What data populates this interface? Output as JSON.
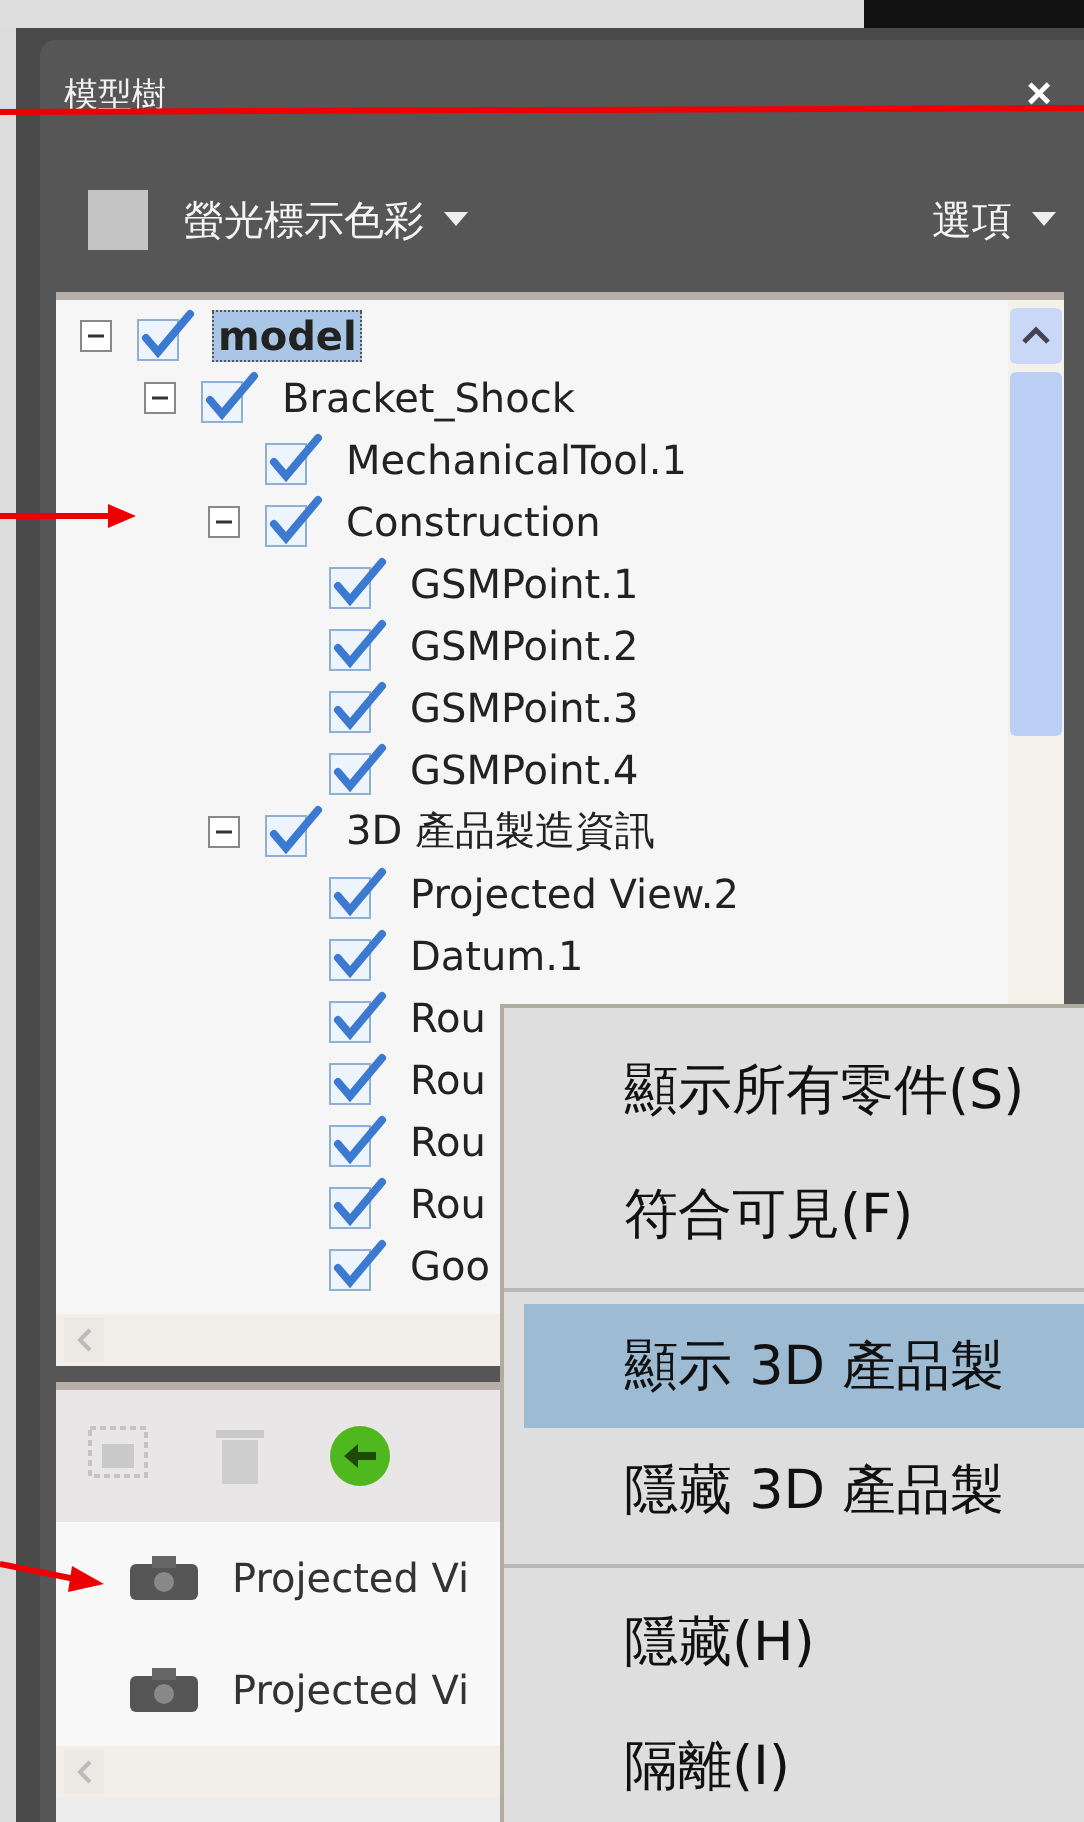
{
  "panel": {
    "title": "模型樹",
    "close": "×"
  },
  "toolbar": {
    "highlight_label": "螢光標示色彩",
    "options_label": "選項"
  },
  "tree": [
    {
      "label": "model",
      "checked": true,
      "selected": true,
      "expanded": true,
      "children": [
        {
          "label": "Bracket_Shock",
          "checked": true,
          "selected": false,
          "expanded": true,
          "children": [
            {
              "label": "MechanicalTool.1",
              "checked": true,
              "selected": false
            },
            {
              "label": "Construction",
              "checked": true,
              "selected": false,
              "expanded": true,
              "children": [
                {
                  "label": "GSMPoint.1",
                  "checked": true,
                  "selected": false
                },
                {
                  "label": "GSMPoint.2",
                  "checked": true,
                  "selected": false
                },
                {
                  "label": "GSMPoint.3",
                  "checked": true,
                  "selected": false
                },
                {
                  "label": "GSMPoint.4",
                  "checked": true,
                  "selected": false
                }
              ]
            },
            {
              "label": "3D 產品製造資訊",
              "checked": true,
              "selected": false,
              "expanded": true,
              "children": [
                {
                  "label": "Projected View.2",
                  "checked": true,
                  "selected": false
                },
                {
                  "label": "Datum.1",
                  "checked": true,
                  "selected": false
                },
                {
                  "label": "Rou",
                  "checked": true,
                  "selected": false
                },
                {
                  "label": "Rou",
                  "checked": true,
                  "selected": false
                },
                {
                  "label": "Rou",
                  "checked": true,
                  "selected": false
                },
                {
                  "label": "Rou",
                  "checked": true,
                  "selected": false
                },
                {
                  "label": "Goo",
                  "checked": true,
                  "selected": false
                }
              ]
            }
          ]
        }
      ]
    }
  ],
  "view_toolbar": [
    {
      "kind": "capture",
      "disabled": true
    },
    {
      "kind": "delete",
      "disabled": true
    },
    {
      "kind": "back",
      "disabled": false
    }
  ],
  "views": [
    {
      "label": "Projected Vi"
    },
    {
      "label": "Projected Vi"
    }
  ],
  "context_menu": [
    {
      "kind": "item",
      "label": "顯示所有零件(S)",
      "selected": false
    },
    {
      "kind": "item",
      "label": "符合可見(F)",
      "selected": false
    },
    {
      "kind": "separator"
    },
    {
      "kind": "item",
      "label": "顯示 3D 產品製",
      "selected": true
    },
    {
      "kind": "item",
      "label": "隱藏 3D 產品製",
      "selected": false
    },
    {
      "kind": "separator"
    },
    {
      "kind": "item",
      "label": "隱藏(H)",
      "selected": false
    },
    {
      "kind": "item",
      "label": "隔離(I)",
      "selected": false
    }
  ]
}
